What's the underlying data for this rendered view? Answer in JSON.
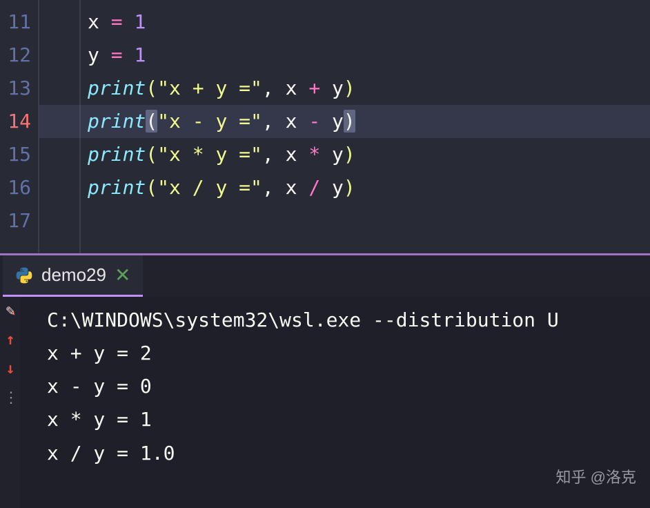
{
  "editor": {
    "lines": [
      {
        "num": "11",
        "indent": "",
        "tokens": [
          {
            "cls": "tok-ident",
            "t": "x "
          },
          {
            "cls": "tok-op",
            "t": "="
          },
          {
            "cls": "tok-ident",
            "t": " "
          },
          {
            "cls": "tok-num",
            "t": "1"
          }
        ]
      },
      {
        "num": "12",
        "indent": "",
        "tokens": [
          {
            "cls": "tok-ident",
            "t": "y "
          },
          {
            "cls": "tok-op",
            "t": "="
          },
          {
            "cls": "tok-ident",
            "t": " "
          },
          {
            "cls": "tok-num",
            "t": "1"
          }
        ]
      },
      {
        "num": "13",
        "indent": "",
        "tokens": [
          {
            "cls": "tok-func",
            "t": "print"
          },
          {
            "cls": "tok-paren-y",
            "t": "("
          },
          {
            "cls": "tok-str",
            "t": "\"x + y =\""
          },
          {
            "cls": "tok-punct",
            "t": ", "
          },
          {
            "cls": "tok-ident",
            "t": "x "
          },
          {
            "cls": "tok-op",
            "t": "+"
          },
          {
            "cls": "tok-ident",
            "t": " y"
          },
          {
            "cls": "tok-paren-y",
            "t": ")"
          }
        ]
      },
      {
        "num": "14",
        "indent": "",
        "active": true,
        "tokens": [
          {
            "cls": "tok-func",
            "t": "print"
          },
          {
            "cls": "tok-paren bracket-highlight",
            "t": "("
          },
          {
            "cls": "tok-str",
            "t": "\"x - y =\""
          },
          {
            "cls": "tok-punct",
            "t": ", "
          },
          {
            "cls": "tok-ident",
            "t": "x "
          },
          {
            "cls": "tok-op",
            "t": "-"
          },
          {
            "cls": "tok-ident",
            "t": " y"
          },
          {
            "cls": "tok-paren bracket-highlight",
            "t": ")"
          }
        ]
      },
      {
        "num": "15",
        "indent": "",
        "tokens": [
          {
            "cls": "tok-func",
            "t": "print"
          },
          {
            "cls": "tok-paren-y",
            "t": "("
          },
          {
            "cls": "tok-str",
            "t": "\"x * y =\""
          },
          {
            "cls": "tok-punct",
            "t": ", "
          },
          {
            "cls": "tok-ident",
            "t": "x "
          },
          {
            "cls": "tok-op",
            "t": "*"
          },
          {
            "cls": "tok-ident",
            "t": " y"
          },
          {
            "cls": "tok-paren-y",
            "t": ")"
          }
        ]
      },
      {
        "num": "16",
        "indent": "",
        "tokens": [
          {
            "cls": "tok-func",
            "t": "print"
          },
          {
            "cls": "tok-paren-y",
            "t": "("
          },
          {
            "cls": "tok-str",
            "t": "\"x / y =\""
          },
          {
            "cls": "tok-punct",
            "t": ", "
          },
          {
            "cls": "tok-ident",
            "t": "x "
          },
          {
            "cls": "tok-op",
            "t": "/"
          },
          {
            "cls": "tok-ident",
            "t": " y"
          },
          {
            "cls": "tok-paren-y",
            "t": ")"
          }
        ]
      },
      {
        "num": "17",
        "indent": "",
        "tokens": []
      }
    ]
  },
  "tab": {
    "label": "demo29",
    "close": "✕"
  },
  "terminal": {
    "lines": [
      "C:\\WINDOWS\\system32\\wsl.exe --distribution U",
      "x + y = 2",
      "x - y = 0",
      "x * y = 1",
      "x / y = 1.0"
    ]
  },
  "watermark": "知乎 @洛克"
}
